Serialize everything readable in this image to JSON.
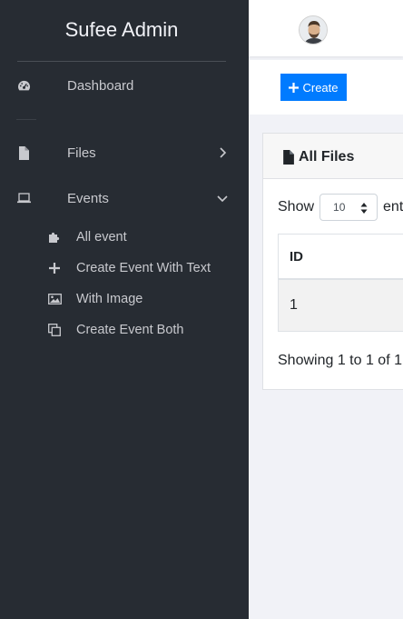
{
  "brand": {
    "light": "Sufee",
    "bold": "Admin"
  },
  "sidebar": {
    "items": [
      {
        "label": "Dashboard",
        "icon": "dashboard-icon"
      },
      {
        "label": "Files",
        "icon": "file-icon",
        "chevron": "chevron-right-icon"
      },
      {
        "label": "Events",
        "icon": "laptop-icon",
        "chevron": "chevron-down-icon"
      }
    ],
    "subitems": [
      {
        "label": "All event",
        "icon": "puzzle-icon"
      },
      {
        "label": "Create Event With Text",
        "icon": "plus-icon"
      },
      {
        "label": "With Image",
        "icon": "image-icon"
      },
      {
        "label": "Create Event Both",
        "icon": "clone-icon"
      }
    ]
  },
  "toolbar": {
    "create_label": "Create"
  },
  "card": {
    "title": "All Files",
    "show_label": "Show",
    "entries_label": "entr",
    "page_size": "10",
    "table": {
      "headers": [
        "ID"
      ],
      "rows": [
        [
          "1"
        ]
      ]
    },
    "info": "Showing 1 to 1 of 1"
  },
  "colors": {
    "sidebar_bg": "#272c33",
    "accent": "#007bff",
    "content_bg": "#f1f2f7"
  }
}
